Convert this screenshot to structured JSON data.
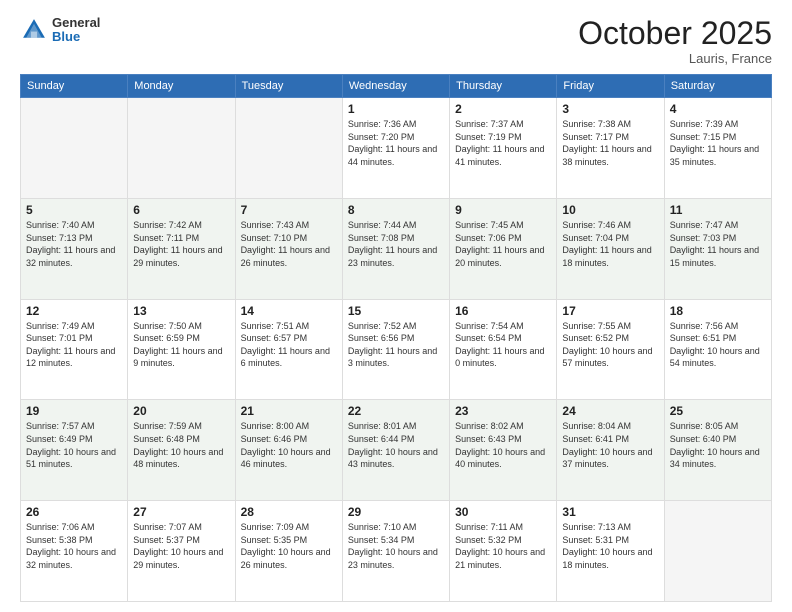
{
  "header": {
    "logo_general": "General",
    "logo_blue": "Blue",
    "month": "October 2025",
    "location": "Lauris, France"
  },
  "days_of_week": [
    "Sunday",
    "Monday",
    "Tuesday",
    "Wednesday",
    "Thursday",
    "Friday",
    "Saturday"
  ],
  "weeks": [
    {
      "shade": false,
      "days": [
        {
          "num": "",
          "info": ""
        },
        {
          "num": "",
          "info": ""
        },
        {
          "num": "",
          "info": ""
        },
        {
          "num": "1",
          "info": "Sunrise: 7:36 AM\nSunset: 7:20 PM\nDaylight: 11 hours\nand 44 minutes."
        },
        {
          "num": "2",
          "info": "Sunrise: 7:37 AM\nSunset: 7:19 PM\nDaylight: 11 hours\nand 41 minutes."
        },
        {
          "num": "3",
          "info": "Sunrise: 7:38 AM\nSunset: 7:17 PM\nDaylight: 11 hours\nand 38 minutes."
        },
        {
          "num": "4",
          "info": "Sunrise: 7:39 AM\nSunset: 7:15 PM\nDaylight: 11 hours\nand 35 minutes."
        }
      ]
    },
    {
      "shade": true,
      "days": [
        {
          "num": "5",
          "info": "Sunrise: 7:40 AM\nSunset: 7:13 PM\nDaylight: 11 hours\nand 32 minutes."
        },
        {
          "num": "6",
          "info": "Sunrise: 7:42 AM\nSunset: 7:11 PM\nDaylight: 11 hours\nand 29 minutes."
        },
        {
          "num": "7",
          "info": "Sunrise: 7:43 AM\nSunset: 7:10 PM\nDaylight: 11 hours\nand 26 minutes."
        },
        {
          "num": "8",
          "info": "Sunrise: 7:44 AM\nSunset: 7:08 PM\nDaylight: 11 hours\nand 23 minutes."
        },
        {
          "num": "9",
          "info": "Sunrise: 7:45 AM\nSunset: 7:06 PM\nDaylight: 11 hours\nand 20 minutes."
        },
        {
          "num": "10",
          "info": "Sunrise: 7:46 AM\nSunset: 7:04 PM\nDaylight: 11 hours\nand 18 minutes."
        },
        {
          "num": "11",
          "info": "Sunrise: 7:47 AM\nSunset: 7:03 PM\nDaylight: 11 hours\nand 15 minutes."
        }
      ]
    },
    {
      "shade": false,
      "days": [
        {
          "num": "12",
          "info": "Sunrise: 7:49 AM\nSunset: 7:01 PM\nDaylight: 11 hours\nand 12 minutes."
        },
        {
          "num": "13",
          "info": "Sunrise: 7:50 AM\nSunset: 6:59 PM\nDaylight: 11 hours\nand 9 minutes."
        },
        {
          "num": "14",
          "info": "Sunrise: 7:51 AM\nSunset: 6:57 PM\nDaylight: 11 hours\nand 6 minutes."
        },
        {
          "num": "15",
          "info": "Sunrise: 7:52 AM\nSunset: 6:56 PM\nDaylight: 11 hours\nand 3 minutes."
        },
        {
          "num": "16",
          "info": "Sunrise: 7:54 AM\nSunset: 6:54 PM\nDaylight: 11 hours\nand 0 minutes."
        },
        {
          "num": "17",
          "info": "Sunrise: 7:55 AM\nSunset: 6:52 PM\nDaylight: 10 hours\nand 57 minutes."
        },
        {
          "num": "18",
          "info": "Sunrise: 7:56 AM\nSunset: 6:51 PM\nDaylight: 10 hours\nand 54 minutes."
        }
      ]
    },
    {
      "shade": true,
      "days": [
        {
          "num": "19",
          "info": "Sunrise: 7:57 AM\nSunset: 6:49 PM\nDaylight: 10 hours\nand 51 minutes."
        },
        {
          "num": "20",
          "info": "Sunrise: 7:59 AM\nSunset: 6:48 PM\nDaylight: 10 hours\nand 48 minutes."
        },
        {
          "num": "21",
          "info": "Sunrise: 8:00 AM\nSunset: 6:46 PM\nDaylight: 10 hours\nand 46 minutes."
        },
        {
          "num": "22",
          "info": "Sunrise: 8:01 AM\nSunset: 6:44 PM\nDaylight: 10 hours\nand 43 minutes."
        },
        {
          "num": "23",
          "info": "Sunrise: 8:02 AM\nSunset: 6:43 PM\nDaylight: 10 hours\nand 40 minutes."
        },
        {
          "num": "24",
          "info": "Sunrise: 8:04 AM\nSunset: 6:41 PM\nDaylight: 10 hours\nand 37 minutes."
        },
        {
          "num": "25",
          "info": "Sunrise: 8:05 AM\nSunset: 6:40 PM\nDaylight: 10 hours\nand 34 minutes."
        }
      ]
    },
    {
      "shade": false,
      "days": [
        {
          "num": "26",
          "info": "Sunrise: 7:06 AM\nSunset: 5:38 PM\nDaylight: 10 hours\nand 32 minutes."
        },
        {
          "num": "27",
          "info": "Sunrise: 7:07 AM\nSunset: 5:37 PM\nDaylight: 10 hours\nand 29 minutes."
        },
        {
          "num": "28",
          "info": "Sunrise: 7:09 AM\nSunset: 5:35 PM\nDaylight: 10 hours\nand 26 minutes."
        },
        {
          "num": "29",
          "info": "Sunrise: 7:10 AM\nSunset: 5:34 PM\nDaylight: 10 hours\nand 23 minutes."
        },
        {
          "num": "30",
          "info": "Sunrise: 7:11 AM\nSunset: 5:32 PM\nDaylight: 10 hours\nand 21 minutes."
        },
        {
          "num": "31",
          "info": "Sunrise: 7:13 AM\nSunset: 5:31 PM\nDaylight: 10 hours\nand 18 minutes."
        },
        {
          "num": "",
          "info": ""
        }
      ]
    }
  ]
}
